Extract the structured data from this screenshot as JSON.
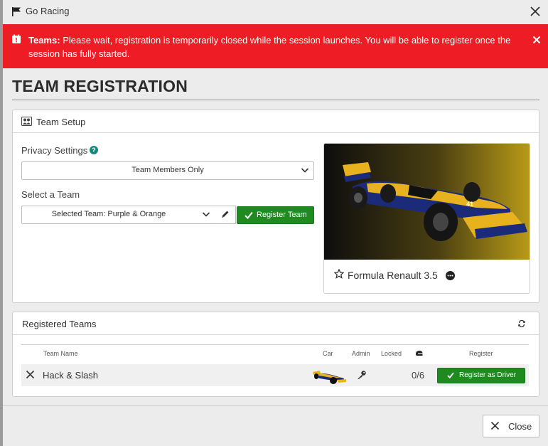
{
  "window": {
    "title": "Go Racing"
  },
  "alert": {
    "label": "Teams:",
    "message": "Please wait, registration is temporarily closed while the session launches. You will be able to register once the session has fully started."
  },
  "page": {
    "heading": "TEAM REGISTRATION"
  },
  "team_setup": {
    "title": "Team Setup",
    "privacy_label": "Privacy Settings",
    "privacy_value": "Team Members Only",
    "select_team_label": "Select a Team",
    "selected_team_value": "Selected Team: Purple & Orange",
    "register_team_label": "Register Team",
    "car_name": "Formula Renault 3.5"
  },
  "registered_teams": {
    "title": "Registered Teams",
    "columns": {
      "team_name": "Team Name",
      "car": "Car",
      "admin": "Admin",
      "locked": "Locked",
      "register": "Register"
    },
    "rows": [
      {
        "team_name": "Hack & Slash",
        "drivers": "0/6",
        "register_label": "Register as Driver"
      }
    ]
  },
  "footer": {
    "close_label": "Close"
  },
  "colors": {
    "alert_bg": "#ee1c25",
    "primary_green": "#1f8a1f",
    "help_teal": "#16897f",
    "car_blue": "#1c2a7a",
    "car_yellow": "#e7b21e"
  },
  "icons": {
    "title": "flag-icon",
    "alert": "calendar-alert-icon",
    "team_setup": "team-members-icon",
    "favorite": "star-icon",
    "more": "ellipsis-circle-icon",
    "refresh": "refresh-icon",
    "admin": "key-icon",
    "drivers": "helmet-icon"
  }
}
